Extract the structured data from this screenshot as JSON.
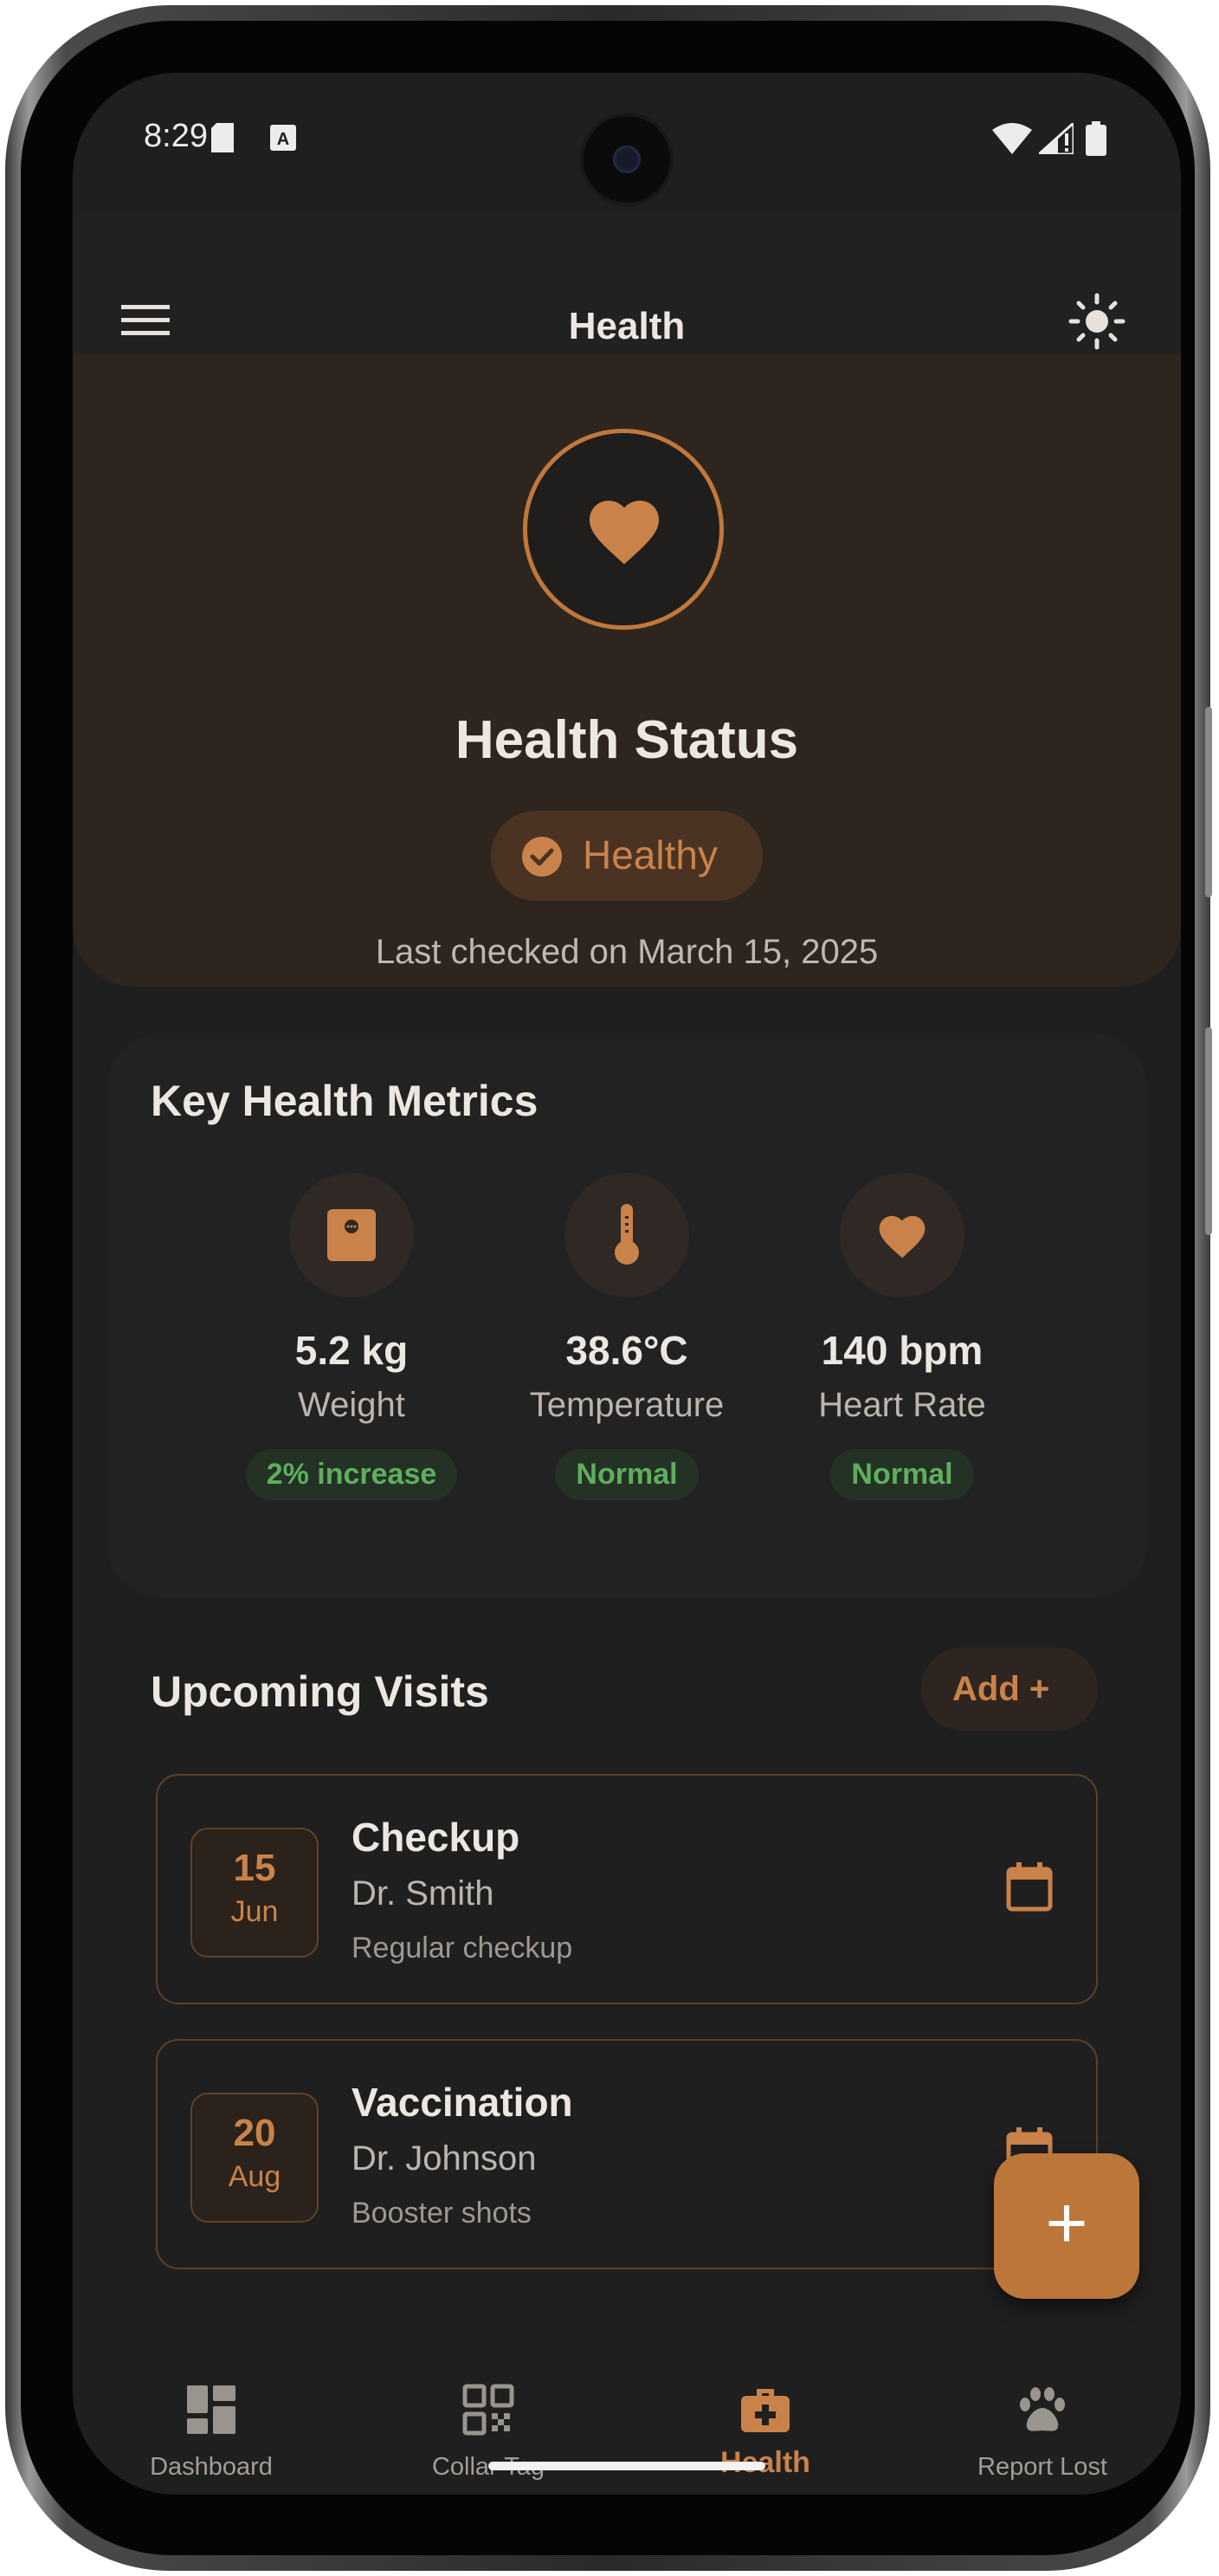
{
  "status_bar": {
    "time": "8:29"
  },
  "app_bar": {
    "title": "Health",
    "menu_icon": "menu-icon",
    "theme_icon": "sun-icon"
  },
  "hero": {
    "icon": "heart-icon",
    "title": "Health Status",
    "status": "Healthy",
    "last_checked": "Last checked on March 15, 2025"
  },
  "metrics": {
    "title": "Key Health Metrics",
    "items": [
      {
        "icon": "scale-icon",
        "value": "5.2 kg",
        "label": "Weight",
        "badge": "2% increase"
      },
      {
        "icon": "thermometer-icon",
        "value": "38.6°C",
        "label": "Temperature",
        "badge": "Normal"
      },
      {
        "icon": "heart-icon",
        "value": "140 bpm",
        "label": "Heart Rate",
        "badge": "Normal"
      }
    ]
  },
  "visits": {
    "title": "Upcoming Visits",
    "add_label": "Add +",
    "items": [
      {
        "day": "15",
        "month": "Jun",
        "title": "Checkup",
        "doctor": "Dr. Smith",
        "note": "Regular checkup"
      },
      {
        "day": "20",
        "month": "Aug",
        "title": "Vaccination",
        "doctor": "Dr. Johnson",
        "note": "Booster shots"
      }
    ]
  },
  "fab": {
    "label": "+"
  },
  "bottom_nav": {
    "items": [
      {
        "label": "Dashboard",
        "icon": "dashboard-icon",
        "active": false
      },
      {
        "label": "Collar Tag",
        "icon": "qr-code-icon",
        "active": false
      },
      {
        "label": "Health",
        "icon": "medical-bag-icon",
        "active": true
      },
      {
        "label": "Report Lost",
        "icon": "paw-icon",
        "active": false
      }
    ]
  },
  "colors": {
    "accent": "#c9834a",
    "success": "#5fae5f",
    "background": "#1f1f1f",
    "hero": "#2e251f"
  }
}
